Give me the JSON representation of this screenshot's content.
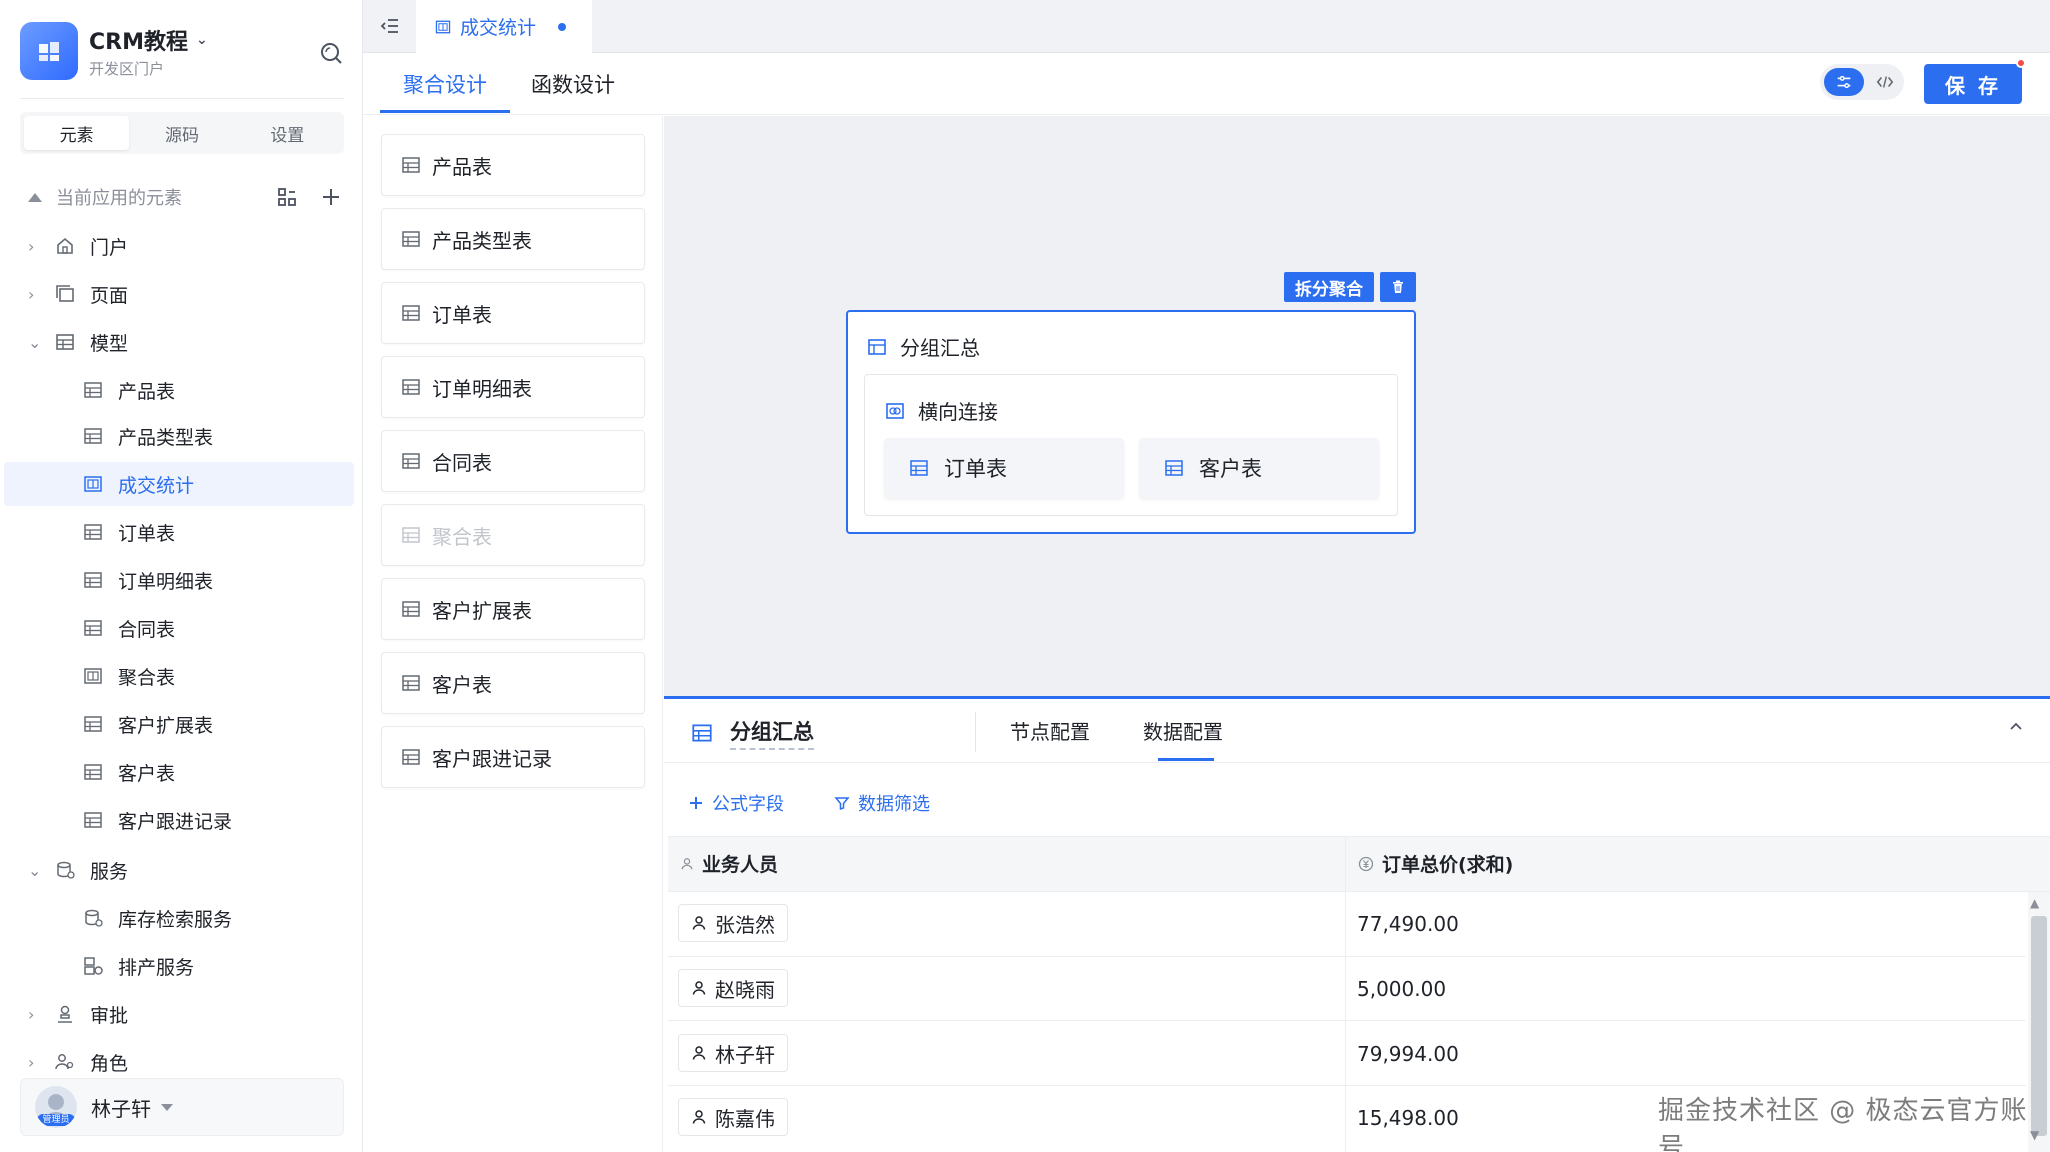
{
  "app": {
    "title": "CRM教程",
    "subtitle": "开发区门户"
  },
  "sidebar": {
    "tabs": [
      {
        "label": "元素",
        "active": true
      },
      {
        "label": "源码",
        "active": false
      },
      {
        "label": "设置",
        "active": false
      }
    ],
    "section_label": "当前应用的元素",
    "tree": {
      "portal": "门户",
      "page": "页面",
      "model": "模型",
      "models": [
        "产品表",
        "产品类型表",
        "成交统计",
        "订单表",
        "订单明细表",
        "合同表",
        "聚合表",
        "客户扩展表",
        "客户表",
        "客户跟进记录"
      ],
      "active_model": "成交统计",
      "service": "服务",
      "services": [
        "库存检索服务",
        "排产服务"
      ],
      "approval": "审批",
      "role": "角色"
    },
    "user": {
      "name": "林子轩",
      "badge": "管理员"
    }
  },
  "topbar": {
    "doc_tab": "成交统计"
  },
  "design_tabs": {
    "aggregate": "聚合设计",
    "function": "函数设计",
    "save": "保 存"
  },
  "element_list": [
    "产品表",
    "产品类型表",
    "订单表",
    "订单明细表",
    "合同表",
    "聚合表",
    "客户扩展表",
    "客户表",
    "客户跟进记录"
  ],
  "element_list_disabled": "聚合表",
  "canvas": {
    "split_button": "拆分聚合",
    "group_node": "分组汇总",
    "join_node": "横向连接",
    "left_table": "订单表",
    "right_table": "客户表"
  },
  "config": {
    "title": "分组汇总",
    "tabs": [
      "节点配置",
      "数据配置"
    ],
    "active_tab": "数据配置",
    "actions": {
      "formula": "公式字段",
      "filter": "数据筛选"
    },
    "columns": [
      "业务人员",
      "订单总价(求和)"
    ],
    "rows": [
      {
        "person": "张浩然",
        "amount": "77,490.00"
      },
      {
        "person": "赵晓雨",
        "amount": "5,000.00"
      },
      {
        "person": "林子轩",
        "amount": "79,994.00"
      },
      {
        "person": "陈嘉伟",
        "amount": "15,498.00"
      }
    ]
  },
  "watermark": "掘金技术社区 @ 极态云官方账号",
  "colors": {
    "accent": "#2b6ef0",
    "canvas_bg": "#eef0f4",
    "notification": "#f54a45"
  }
}
